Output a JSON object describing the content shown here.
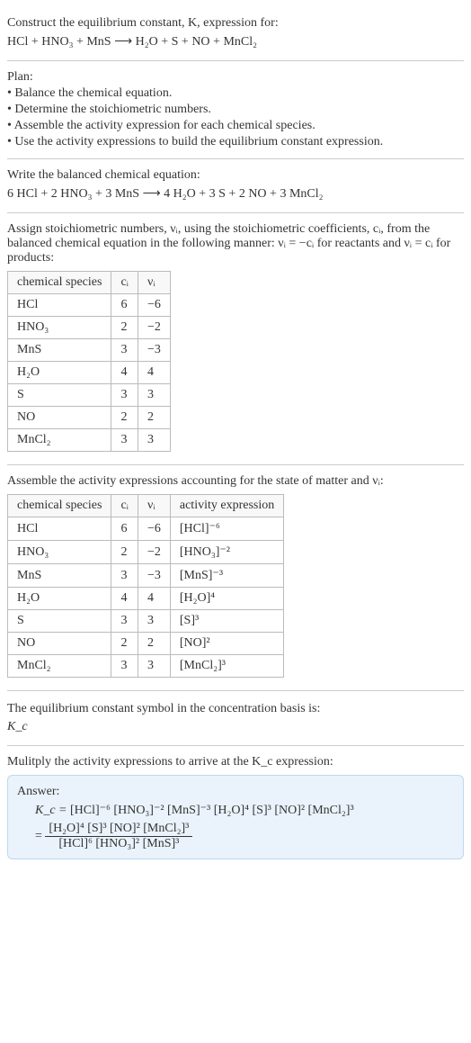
{
  "header": {
    "prompt": "Construct the equilibrium constant, K, expression for:",
    "unbalanced": "HCl + HNO₃ + MnS ⟶ H₂O + S + NO + MnCl₂"
  },
  "plan": {
    "title": "Plan:",
    "items": [
      "• Balance the chemical equation.",
      "• Determine the stoichiometric numbers.",
      "• Assemble the activity expression for each chemical species.",
      "• Use the activity expressions to build the equilibrium constant expression."
    ]
  },
  "balanced": {
    "intro": "Write the balanced chemical equation:",
    "equation": "6 HCl + 2 HNO₃ + 3 MnS ⟶ 4 H₂O + 3 S + 2 NO + 3 MnCl₂"
  },
  "stoich": {
    "intro": "Assign stoichiometric numbers, νᵢ, using the stoichiometric coefficients, cᵢ, from the balanced chemical equation in the following manner: νᵢ = −cᵢ for reactants and νᵢ = cᵢ for products:",
    "headers": [
      "chemical species",
      "cᵢ",
      "νᵢ"
    ],
    "rows": [
      [
        "HCl",
        "6",
        "−6"
      ],
      [
        "HNO₃",
        "2",
        "−2"
      ],
      [
        "MnS",
        "3",
        "−3"
      ],
      [
        "H₂O",
        "4",
        "4"
      ],
      [
        "S",
        "3",
        "3"
      ],
      [
        "NO",
        "2",
        "2"
      ],
      [
        "MnCl₂",
        "3",
        "3"
      ]
    ]
  },
  "activity": {
    "intro": "Assemble the activity expressions accounting for the state of matter and νᵢ:",
    "headers": [
      "chemical species",
      "cᵢ",
      "νᵢ",
      "activity expression"
    ],
    "rows": [
      [
        "HCl",
        "6",
        "−6",
        "[HCl]⁻⁶"
      ],
      [
        "HNO₃",
        "2",
        "−2",
        "[HNO₃]⁻²"
      ],
      [
        "MnS",
        "3",
        "−3",
        "[MnS]⁻³"
      ],
      [
        "H₂O",
        "4",
        "4",
        "[H₂O]⁴"
      ],
      [
        "S",
        "3",
        "3",
        "[S]³"
      ],
      [
        "NO",
        "2",
        "2",
        "[NO]²"
      ],
      [
        "MnCl₂",
        "3",
        "3",
        "[MnCl₂]³"
      ]
    ]
  },
  "symbol": {
    "line1": "The equilibrium constant symbol in the concentration basis is:",
    "line2": "K_c"
  },
  "multiply": {
    "intro": "Mulitply the activity expressions to arrive at the K_c expression:"
  },
  "answer": {
    "label": "Answer:",
    "kc_label": "K_c =",
    "product": "[HCl]⁻⁶ [HNO₃]⁻² [MnS]⁻³ [H₂O]⁴ [S]³ [NO]² [MnCl₂]³",
    "eq": "=",
    "numerator": "[H₂O]⁴ [S]³ [NO]² [MnCl₂]³",
    "denominator": "[HCl]⁶ [HNO₃]² [MnS]³"
  }
}
